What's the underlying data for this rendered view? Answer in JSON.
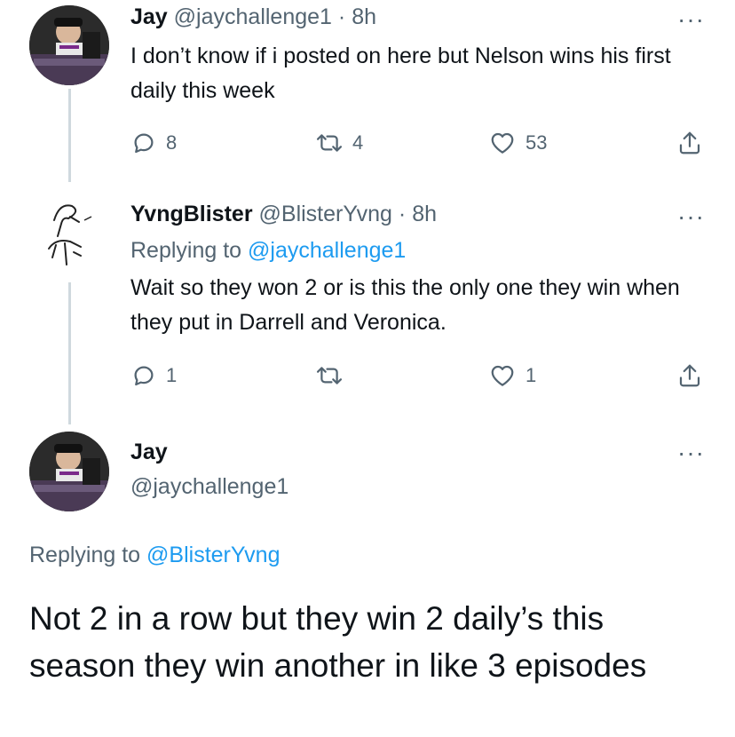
{
  "tweet1": {
    "name": "Jay",
    "handle": "@jaychallenge1",
    "sep": "·",
    "time": "8h",
    "text": "I don’t know if i posted on here but Nelson wins his first daily this week",
    "replies": "8",
    "retweets": "4",
    "likes": "53"
  },
  "tweet2": {
    "name": "YvngBlister",
    "handle": "@BlisterYvng",
    "sep": "·",
    "time": "8h",
    "replying_prefix": "Replying to",
    "replying_handle": "@jaychallenge1",
    "text": "Wait so they won 2 or is this the only one they win when they put in Darrell and Veronica.",
    "replies": "1",
    "likes": "1"
  },
  "tweet3": {
    "name": "Jay",
    "handle": "@jaychallenge1",
    "replying_prefix": "Replying to",
    "replying_handle": "@BlisterYvng",
    "text": "Not 2 in a row but they win 2 daily’s this season they win another in like 3 episodes"
  },
  "more_glyph": "···",
  "colors": {
    "text": "#0f1419",
    "muted": "#536471",
    "link": "#1d9bf0",
    "line": "#cfd9de"
  }
}
